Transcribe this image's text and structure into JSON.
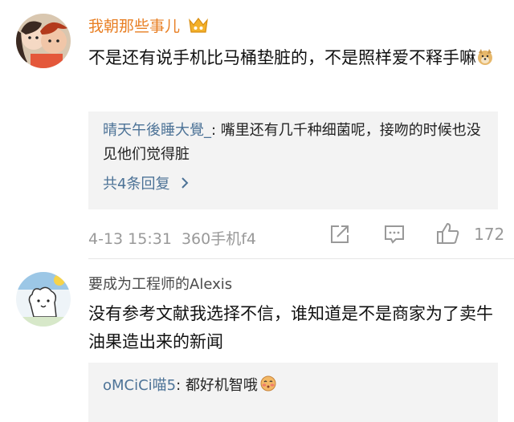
{
  "comments": [
    {
      "username": "我朝那些事儿",
      "username_color": "#e87f24",
      "text": "不是还有说手机比马桶垫脏的，不是照样爱不释手嘛",
      "emoji": "doge-emoji",
      "badge": "crown-icon",
      "reply": {
        "author": "晴天午後睡大覺_",
        "separator": ": ",
        "text": "嘴里还有几千种细菌呢，接吻的时候也没见他们觉得脏",
        "more_label": "共4条回复",
        "more_icon": "chevron-right-icon"
      },
      "timestamp": "4-13 15:31",
      "source": "360手机f4",
      "like_count": "172"
    },
    {
      "username": "要成为工程师的Alexis",
      "username_color": "#4a4a4a",
      "text": "没有参考文献我选择不信，谁知道是不是商家为了卖牛油果造出来的新闻",
      "reply": {
        "author": "oMCiCi喵5",
        "separator": ": ",
        "text": "都好机智哦",
        "emoji": "shy-emoji"
      }
    }
  ],
  "colors": {
    "link": "#4d7397",
    "meta": "#999999",
    "reply_bg": "#f3f3f3"
  }
}
